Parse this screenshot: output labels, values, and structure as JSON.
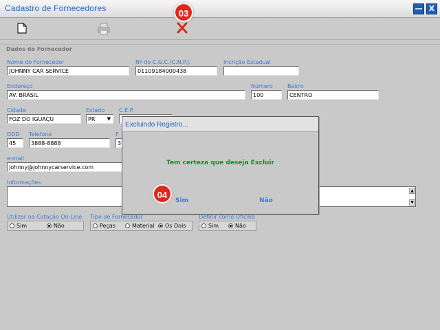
{
  "window": {
    "title": "Cadastro de Fornecedores",
    "minimize_label": "—",
    "close_label": "X"
  },
  "toolbar": {
    "new_icon": "new-document-icon",
    "print_icon": "printer-icon",
    "delete_icon": "delete-x-icon"
  },
  "badges": {
    "delete_step": "03",
    "confirm_step": "04"
  },
  "section_title": "Dados do Fornecedor",
  "fields": {
    "nome": {
      "label": "Nome do Fornecedor",
      "value": "JOHNNY CAR SERVICE"
    },
    "cnpj": {
      "label": "Nº do C.G.C./C.N.P.J.",
      "value": "01109184000438"
    },
    "ie": {
      "label": "Incrição Estadual",
      "value": ""
    },
    "endereco": {
      "label": "Endereço",
      "value": "AV. BRASIL"
    },
    "numero": {
      "label": "Número",
      "value": "100"
    },
    "bairro": {
      "label": "Bairro",
      "value": "CENTRO"
    },
    "cidade": {
      "label": "Cidade",
      "value": "FOZ DO IGUAÇU"
    },
    "estado": {
      "label": "Estado",
      "value": "PR"
    },
    "cep": {
      "label": "C.E.P.",
      "value": ""
    },
    "ddd": {
      "label": "DDD",
      "value": "45"
    },
    "telefone": {
      "label": "Telefone",
      "value": "3888-8888"
    },
    "fax": {
      "label": "F",
      "value": "3"
    },
    "email": {
      "label": "e-mail",
      "value": "johnny@johnnycarservice.com"
    },
    "informacoes": {
      "label": "Informações",
      "value": ""
    }
  },
  "options": {
    "cotacao": {
      "label": "Utilizar na Cotação On-Line",
      "items": [
        "Sim",
        "Não"
      ],
      "selected": "Não"
    },
    "tipo": {
      "label": "Tipo de Fornecedor",
      "items": [
        "Peças",
        "Material",
        "Os Dois"
      ],
      "selected": "Os Dois"
    },
    "oficina": {
      "label": "Definir como Oficina",
      "items": [
        "Sim",
        "Não"
      ],
      "selected": "Não"
    }
  },
  "dialog": {
    "title": "Excluindo Registro...",
    "message": "Tem certeza que deseja Excluir",
    "yes_label": "Sim",
    "no_label": "Não"
  },
  "colors": {
    "label_blue": "#3a7bd5",
    "title_blue": "#1e66c8",
    "badge_red": "#e0261f",
    "message_green": "#1a8a2a"
  }
}
